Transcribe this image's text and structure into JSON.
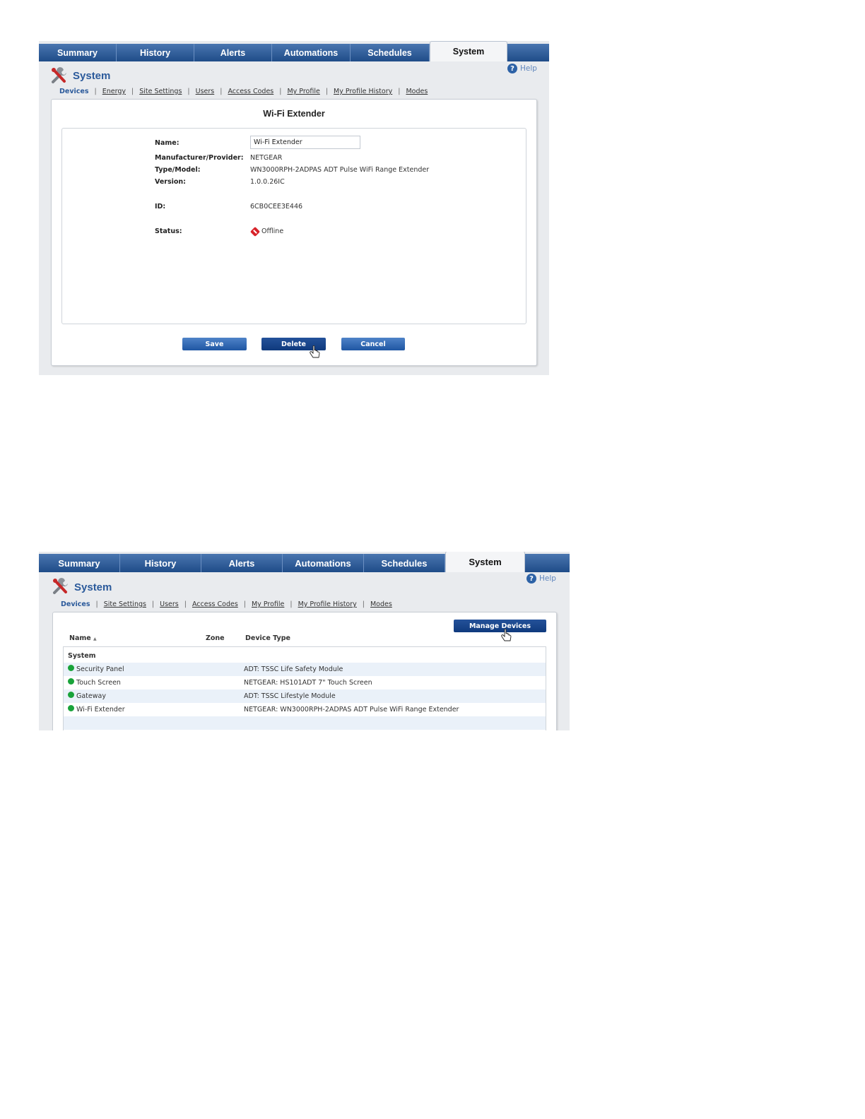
{
  "tabs": [
    "Summary",
    "History",
    "Alerts",
    "Automations",
    "Schedules",
    "System"
  ],
  "active_tab": "System",
  "header": {
    "title": "System",
    "help_label": "Help"
  },
  "subnav1": [
    "Devices",
    "Energy",
    "Site Settings",
    "Users",
    "Access Codes",
    "My Profile",
    "My Profile History",
    "Modes"
  ],
  "subnav2": [
    "Devices",
    "Site Settings",
    "Users",
    "Access Codes",
    "My Profile",
    "My Profile History",
    "Modes"
  ],
  "device_detail": {
    "title": "Wi-Fi Extender",
    "fields": {
      "name_label": "Name:",
      "name_value": "Wi-Fi Extender",
      "manufacturer_label": "Manufacturer/Provider:",
      "manufacturer_value": "NETGEAR",
      "type_label": "Type/Model:",
      "type_value": "WN3000RPH-2ADPAS ADT Pulse WiFi Range Extender",
      "version_label": "Version:",
      "version_value": "1.0.0.26IC",
      "id_label": "ID:",
      "id_value": "6CB0CEE3E446",
      "status_label": "Status:",
      "status_value": "Offline"
    },
    "buttons": {
      "save": "Save",
      "delete": "Delete",
      "cancel": "Cancel"
    }
  },
  "device_list": {
    "manage_button": "Manage Devices",
    "columns": {
      "name": "Name",
      "sort_indicator": "▲",
      "zone": "Zone",
      "device_type": "Device Type"
    },
    "group": "System",
    "rows": [
      {
        "name": "Security Panel",
        "device_type": "ADT: TSSC Life Safety Module"
      },
      {
        "name": "Touch Screen",
        "device_type": "NETGEAR: HS101ADT 7\" Touch Screen"
      },
      {
        "name": "Gateway",
        "device_type": "ADT: TSSC Lifestyle Module"
      },
      {
        "name": "Wi-Fi Extender",
        "device_type": "NETGEAR: WN3000RPH-2ADPAS ADT Pulse WiFi Range Extender"
      }
    ]
  },
  "colors": {
    "tab_bar": "#1f4c88",
    "accent": "#2b5a9b",
    "online": "#19a33a",
    "offline": "#d8232a",
    "row_alt": "#eaf1f9"
  }
}
